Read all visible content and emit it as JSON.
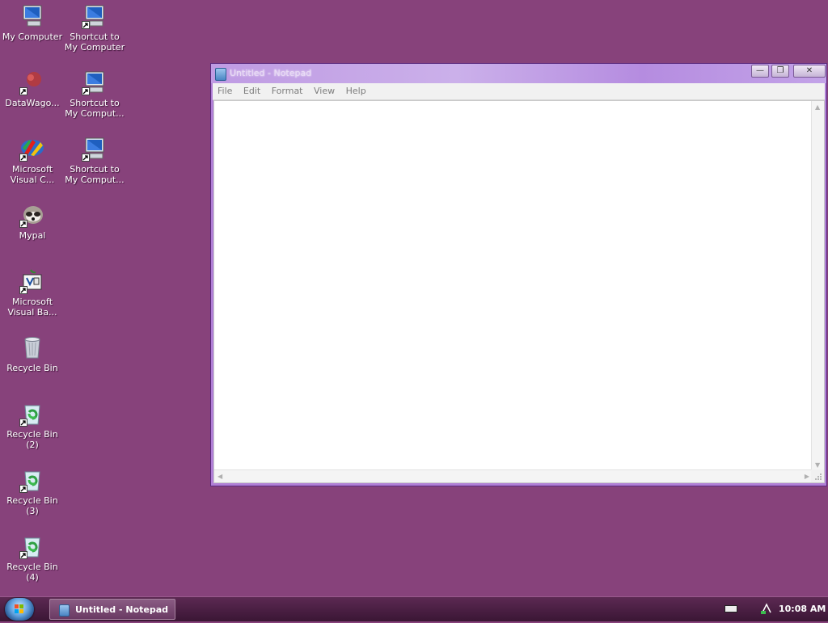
{
  "desktop": {
    "icons": [
      {
        "label": "My Computer"
      },
      {
        "label": "Shortcut to My Computer"
      },
      {
        "label": "DataWago..."
      },
      {
        "label": "Shortcut to My Comput..."
      },
      {
        "label": "Microsoft Visual C..."
      },
      {
        "label": "Shortcut to My Comput..."
      },
      {
        "label": "Mypal"
      },
      {
        "label": "Microsoft Visual Ba..."
      },
      {
        "label": "Recycle Bin"
      },
      {
        "label": "Recycle Bin (2)"
      },
      {
        "label": "Recycle Bin (3)"
      },
      {
        "label": "Recycle Bin (4)"
      }
    ]
  },
  "notepad": {
    "title": "Untitled - Notepad",
    "menu": [
      "File",
      "Edit",
      "Format",
      "View",
      "Help"
    ],
    "content": "",
    "controls": {
      "minimize": "—",
      "maximize": "❐",
      "close": "✕"
    }
  },
  "taskbar": {
    "task_label": "Untitled - Notepad",
    "clock": "10:08 AM"
  },
  "colors": {
    "desktop": "#87427b",
    "window_border": "#b07fd6",
    "taskbar": "#4a1d42"
  }
}
